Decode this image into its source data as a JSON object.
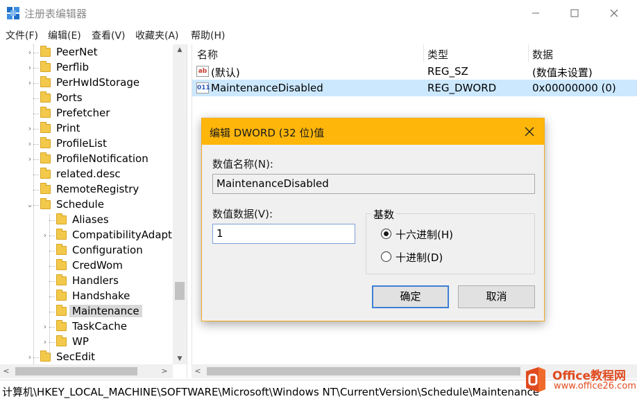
{
  "window": {
    "title": "注册表编辑器"
  },
  "menu": [
    "文件(F)",
    "编辑(E)",
    "查看(V)",
    "收藏夹(A)",
    "帮助(H)"
  ],
  "tree": {
    "items": [
      {
        "label": "PeerNet",
        "expandable": true
      },
      {
        "label": "Perflib",
        "expandable": true
      },
      {
        "label": "PerHwIdStorage",
        "expandable": true
      },
      {
        "label": "Ports",
        "expandable": false
      },
      {
        "label": "Prefetcher",
        "expandable": false
      },
      {
        "label": "Print",
        "expandable": true
      },
      {
        "label": "ProfileList",
        "expandable": true
      },
      {
        "label": "ProfileNotification",
        "expandable": true
      },
      {
        "label": "related.desc",
        "expandable": false
      },
      {
        "label": "RemoteRegistry",
        "expandable": false
      },
      {
        "label": "Schedule",
        "expanded": true
      },
      {
        "label": "Aliases",
        "child": true
      },
      {
        "label": "CompatibilityAdapt",
        "child": true,
        "expandable": true
      },
      {
        "label": "Configuration",
        "child": true
      },
      {
        "label": "CredWom",
        "child": true
      },
      {
        "label": "Handlers",
        "child": true
      },
      {
        "label": "Handshake",
        "child": true
      },
      {
        "label": "Maintenance",
        "child": true,
        "selected": true
      },
      {
        "label": "TaskCache",
        "child": true,
        "expandable": true
      },
      {
        "label": "WP",
        "child": true,
        "expandable": true
      },
      {
        "label": "SecEdit",
        "expandable": true
      }
    ]
  },
  "list": {
    "columns": [
      "名称",
      "类型",
      "数据"
    ],
    "rows": [
      {
        "name": "(默认)",
        "type": "REG_SZ",
        "data": "(数值未设置)",
        "icon": "string-value-icon"
      },
      {
        "name": "MaintenanceDisabled",
        "type": "REG_DWORD",
        "data": "0x00000000 (0)",
        "icon": "dword-value-icon",
        "selected": true
      }
    ]
  },
  "status": {
    "path": "计算机\\HKEY_LOCAL_MACHINE\\SOFTWARE\\Microsoft\\Windows NT\\CurrentVersion\\Schedule\\Maintenance"
  },
  "dialog": {
    "title": "编辑 DWORD (32 位)值",
    "name_label": "数值名称(N):",
    "name_value": "MaintenanceDisabled",
    "data_label": "数值数据(V):",
    "data_value": "1",
    "base_label": "基数",
    "hex_label": "十六进制(H)",
    "dec_label": "十进制(D)",
    "base_selected": "hex",
    "ok_label": "确定",
    "cancel_label": "取消"
  },
  "watermark": {
    "name": "Office教程网",
    "url": "www.office26.com"
  },
  "colors": {
    "dialog_title": "#ffb60a",
    "selection": "#cce8ff",
    "watermark": "#e04a1f"
  }
}
